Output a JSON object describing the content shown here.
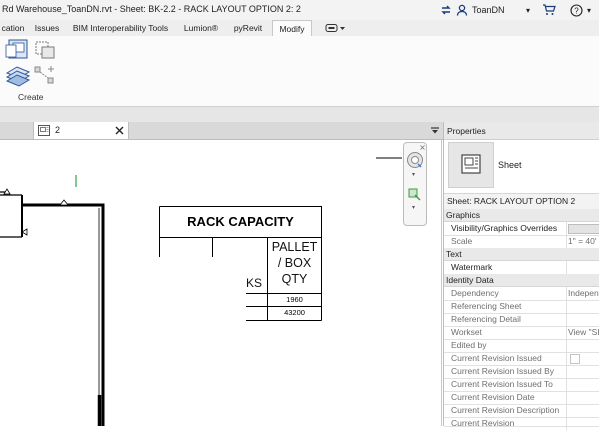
{
  "titlebar": {
    "title": "Rd Warehouse_ToanDN.rvt - Sheet: BK-2.2 - RACK LAYOUT OPTION 2: 2",
    "user": "ToanDN"
  },
  "ribbon": {
    "tabs": [
      {
        "label": "cation"
      },
      {
        "label": "Issues"
      },
      {
        "label": "BIM Interoperability Tools"
      },
      {
        "label": "Lumion®"
      },
      {
        "label": "pyRevit"
      },
      {
        "label": "Modify"
      }
    ],
    "active_tab": "Modify",
    "panel_label": "Create"
  },
  "view_tab": {
    "label": "2"
  },
  "drawing": {
    "table_title": "RACK CAPACITY",
    "column_header": [
      "PALLET",
      "/ BOX",
      "QTY"
    ],
    "partial_header": "KS",
    "rows": [
      "1960",
      "43200"
    ]
  },
  "properties": {
    "header": "Properties",
    "type_name": "Sheet",
    "instance_selector": "Sheet: RACK LAYOUT OPTION 2",
    "groups": [
      {
        "name": "Graphics",
        "rows": [
          {
            "name": "Visibility/Graphics Overrides",
            "value": "",
            "enabled": true
          },
          {
            "name": "Scale",
            "value": "1\" = 40'",
            "enabled": false
          }
        ]
      },
      {
        "name": "Text",
        "rows": [
          {
            "name": "Watermark",
            "value": "",
            "enabled": true
          }
        ]
      },
      {
        "name": "Identity Data",
        "rows": [
          {
            "name": "Dependency",
            "value": "Indepen",
            "enabled": false
          },
          {
            "name": "Referencing Sheet",
            "value": "",
            "enabled": false
          },
          {
            "name": "Referencing Detail",
            "value": "",
            "enabled": false
          },
          {
            "name": "Workset",
            "value": "View \"SH",
            "enabled": false
          },
          {
            "name": "Edited by",
            "value": "",
            "enabled": false
          },
          {
            "name": "Current Revision Issued",
            "value": "",
            "enabled": false
          },
          {
            "name": "Current Revision Issued By",
            "value": "",
            "enabled": false
          },
          {
            "name": "Current Revision Issued To",
            "value": "",
            "enabled": false
          },
          {
            "name": "Current Revision Date",
            "value": "",
            "enabled": false
          },
          {
            "name": "Current Revision Description",
            "value": "",
            "enabled": false
          },
          {
            "name": "Current Revision",
            "value": "",
            "enabled": false
          }
        ]
      }
    ]
  },
  "colors": {
    "accent": "#1a5fb4",
    "ribbon_bg": "#fbfbfb",
    "group_bg": "#e9e9e9"
  }
}
